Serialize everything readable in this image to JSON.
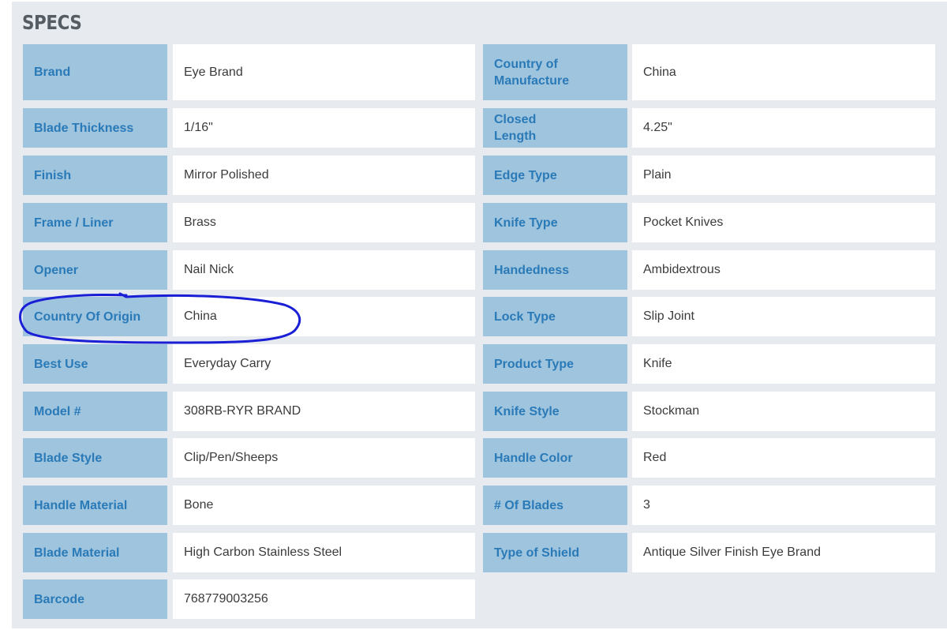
{
  "section": {
    "title": "SPECS"
  },
  "left_specs": [
    {
      "label": "Brand",
      "value": "Eye Brand"
    },
    {
      "label": "Blade Thickness",
      "value": "1/16\""
    },
    {
      "label": "Finish",
      "value": "Mirror Polished"
    },
    {
      "label": "Frame / Liner",
      "value": "Brass"
    },
    {
      "label": "Opener",
      "value": "Nail Nick"
    },
    {
      "label": "Country Of Origin",
      "value": "China"
    },
    {
      "label": "Best Use",
      "value": "Everyday Carry"
    },
    {
      "label": "Model #",
      "value": "308RB-RYR BRAND"
    },
    {
      "label": "Blade Style",
      "value": "Clip/Pen/Sheeps"
    },
    {
      "label": "Handle Material",
      "value": "Bone"
    },
    {
      "label": "Blade Material",
      "value": "High Carbon Stainless Steel"
    },
    {
      "label": "Barcode",
      "value": "768779003256"
    }
  ],
  "right_specs": [
    {
      "label": "Country of Manufacture",
      "value": "China"
    },
    {
      "label": "Closed Length",
      "value": "4.25\""
    },
    {
      "label": "Edge Type",
      "value": "Plain"
    },
    {
      "label": "Knife Type",
      "value": "Pocket Knives"
    },
    {
      "label": "Handedness",
      "value": "Ambidextrous"
    },
    {
      "label": "Lock Type",
      "value": "Slip Joint"
    },
    {
      "label": "Product Type",
      "value": "Knife"
    },
    {
      "label": "Knife Style",
      "value": "Stockman"
    },
    {
      "label": "Handle Color",
      "value": "Red"
    },
    {
      "label": "# Of Blades",
      "value": "3"
    },
    {
      "label": "Type of Shield",
      "value": "Antique Silver Finish Eye Brand"
    }
  ],
  "colors": {
    "label_bg": "#9fc4de",
    "label_text": "#2a7ab8",
    "panel_bg": "#e7ebef",
    "annotation_stroke": "#1a1fd6"
  }
}
